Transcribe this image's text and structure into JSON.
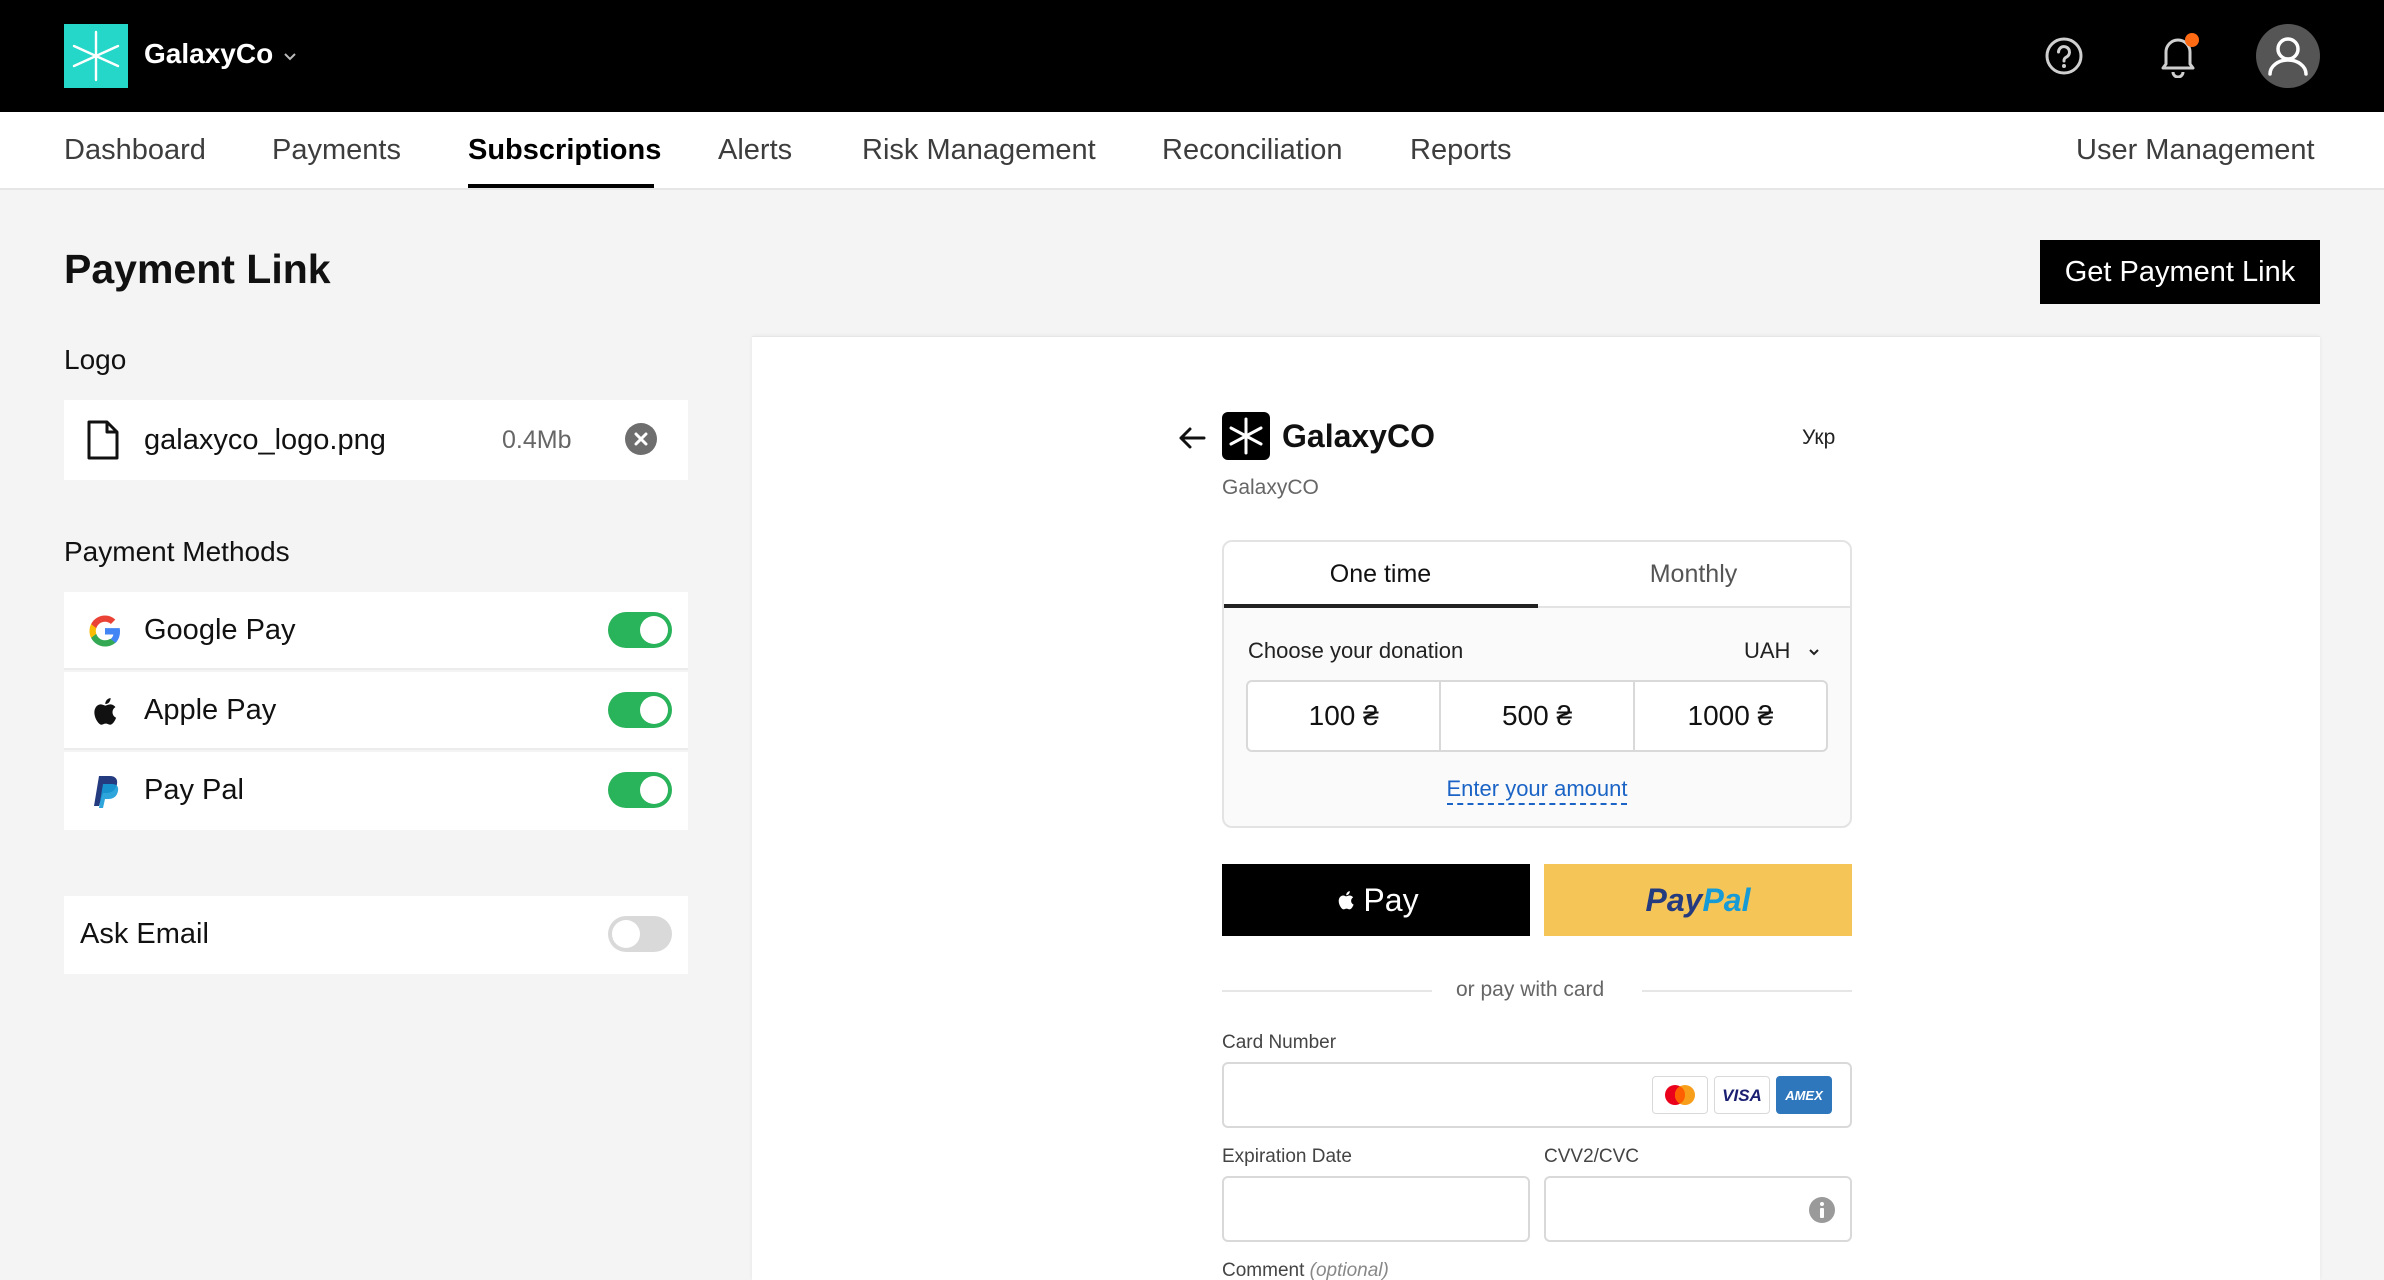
{
  "topbar": {
    "brand": "GalaxyCo",
    "icons": [
      "galaxyco-logo-icon",
      "chevron-down-icon",
      "help-icon",
      "bell-icon",
      "user-avatar-icon"
    ],
    "notification_dot_color": "#ff6a13"
  },
  "nav": {
    "items": [
      {
        "label": "Dashboard"
      },
      {
        "label": "Payments"
      },
      {
        "label": "Subscriptions",
        "active": true
      },
      {
        "label": "Alerts"
      },
      {
        "label": "Risk Management"
      },
      {
        "label": "Reconciliation"
      },
      {
        "label": "Reports"
      }
    ],
    "user_management": "User Management"
  },
  "page": {
    "title": "Payment Link",
    "get_link_button": "Get Payment Link"
  },
  "logo_section": {
    "label": "Logo",
    "file_name": "galaxyco_logo.png",
    "file_size": "0.4Mb"
  },
  "payment_methods": {
    "label": "Payment Methods",
    "items": [
      {
        "label": "Google Pay",
        "icon": "google-icon",
        "enabled": true
      },
      {
        "label": "Apple Pay",
        "icon": "apple-icon",
        "enabled": true
      },
      {
        "label": "Pay Pal",
        "icon": "paypal-icon",
        "enabled": true
      }
    ]
  },
  "ask_email": {
    "label": "Ask Email",
    "enabled": false
  },
  "preview": {
    "merchant_name": "GalaxyCO",
    "merchant_sub": "GalaxyCO",
    "language": "Укр",
    "tabs": [
      {
        "label": "One time",
        "active": true
      },
      {
        "label": "Monthly"
      }
    ],
    "choose_label": "Choose your donation",
    "currency": "UAH",
    "amounts": [
      "100 ₴",
      "500 ₴",
      "1000 ₴"
    ],
    "enter_amount": "Enter your amount",
    "apple_pay_label": "Pay",
    "paypal_pay": "Pay",
    "paypal_pal": "Pal",
    "or_pay_with_card": "or pay with card",
    "card_number_label": "Card Number",
    "card_brands": [
      "mastercard-icon",
      "visa-icon",
      "amex-icon"
    ],
    "visa_text": "VISA",
    "amex_text": "AMEX",
    "expiration_label": "Expiration Date",
    "cvv_label": "CVV2/CVC",
    "comment_label": "Comment",
    "comment_optional": "(optional)"
  },
  "colors": {
    "toggle_on": "#29b35a",
    "toggle_off": "#d9d9d9",
    "brand_teal": "#25d7c8",
    "link_blue": "#1b64c6",
    "paypal_yellow": "#f5c557"
  }
}
